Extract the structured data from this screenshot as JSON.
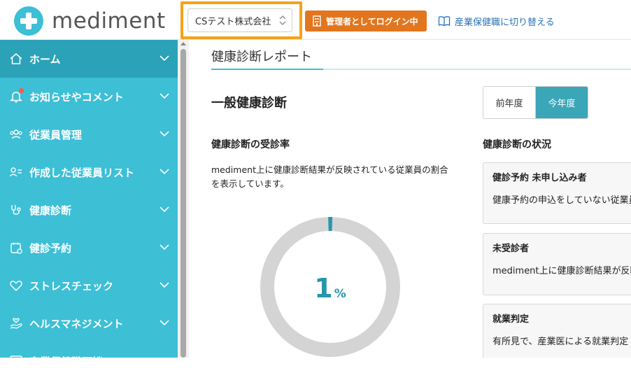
{
  "header": {
    "logo_text": "mediment",
    "company_select": "CSテスト株式会社",
    "admin_button": "管理者としてログイン中",
    "switch_link": "産業保健職に切り替える"
  },
  "sidebar": {
    "items": [
      {
        "label": "ホーム",
        "icon": "home-icon"
      },
      {
        "label": "お知らせやコメント",
        "icon": "bell-icon"
      },
      {
        "label": "従業員管理",
        "icon": "users-icon"
      },
      {
        "label": "作成した従業員リスト",
        "icon": "user-list-icon"
      },
      {
        "label": "健康診断",
        "icon": "stethoscope-icon"
      },
      {
        "label": "健診予約",
        "icon": "calendar-icon"
      },
      {
        "label": "ストレスチェック",
        "icon": "heart-icon"
      },
      {
        "label": "ヘルスマネジメント",
        "icon": "hand-heart-icon"
      },
      {
        "label": "産業保健職面談",
        "icon": "chat-icon"
      }
    ]
  },
  "main": {
    "page_title": "健康診断レポート",
    "section_title": "一般健康診断",
    "year_toggle": {
      "prev": "前年度",
      "current": "今年度",
      "selected": "今年度"
    },
    "rate": {
      "title": "健康診断の受診率",
      "description": "mediment上に健康診断結果が反映されている従業員の割合を表示しています。",
      "value": 1,
      "unit": "%"
    },
    "status": {
      "title": "健康診断の状況",
      "cards": [
        {
          "title": "健診予約 未申し込み者",
          "desc": "健康予約の申込をしていない従業員"
        },
        {
          "title": "未受診者",
          "desc": "mediment上に健康診断結果が反映されていない"
        },
        {
          "title": "就業判定",
          "desc": "有所見で、産業医による就業判定"
        }
      ]
    }
  },
  "colors": {
    "accent": "#3dbfd6",
    "accent_dark": "#2ba2b8",
    "admin_orange": "#e2761e",
    "highlight": "#f6a21b",
    "donut_track": "#d4d4d4",
    "donut_value": "#2796ad"
  }
}
